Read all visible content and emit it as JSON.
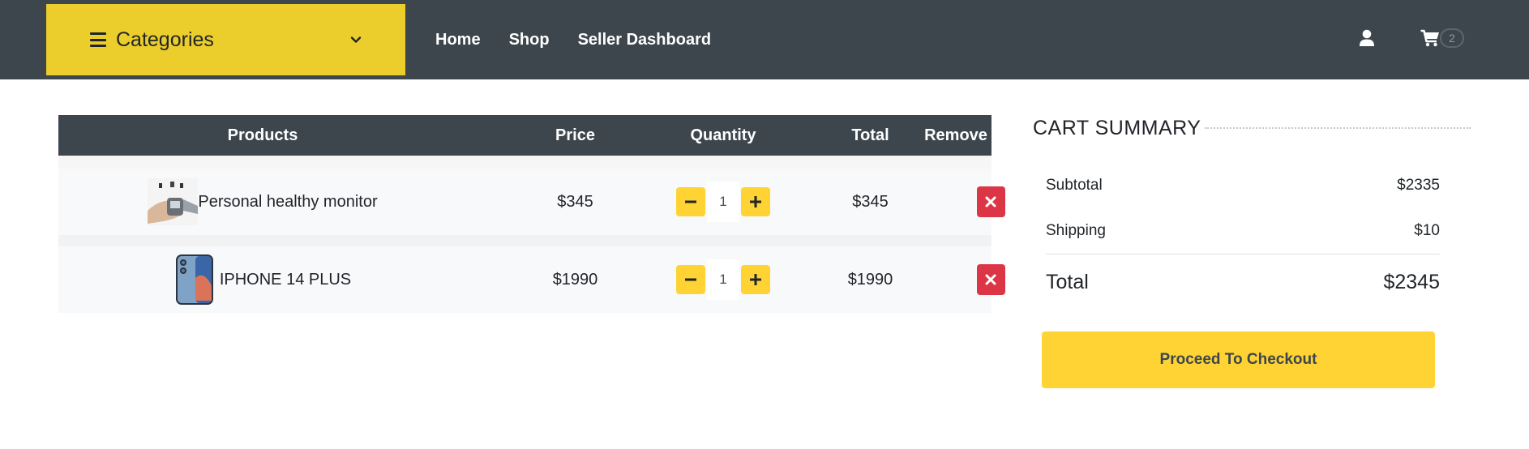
{
  "navbar": {
    "categories_label": "Categories",
    "links": [
      "Home",
      "Shop",
      "Seller Dashboard"
    ],
    "cart_count": "2",
    "icons": [
      "bars-icon",
      "chevron-down-icon",
      "user-icon",
      "cart-icon"
    ]
  },
  "table": {
    "headers": {
      "products": "Products",
      "price": "Price",
      "quantity": "Quantity",
      "total": "Total",
      "remove": "Remove"
    },
    "rows": [
      {
        "name": "Personal healthy monitor",
        "price": "$345",
        "quantity": "1",
        "total": "$345"
      },
      {
        "name": "IPHONE 14 PLUS",
        "price": "$1990",
        "quantity": "1",
        "total": "$1990"
      }
    ]
  },
  "summary": {
    "title": "CART SUMMARY",
    "subtotal_label": "Subtotal",
    "subtotal_value": "$2335",
    "shipping_label": "Shipping",
    "shipping_value": "$10",
    "total_label": "Total",
    "total_value": "$2345",
    "checkout_label": "Proceed To Checkout"
  },
  "colors": {
    "navbar": "#3d464d",
    "accent": "#ffd333",
    "categories_bg": "#ebcd2c",
    "danger": "#dc3545"
  }
}
